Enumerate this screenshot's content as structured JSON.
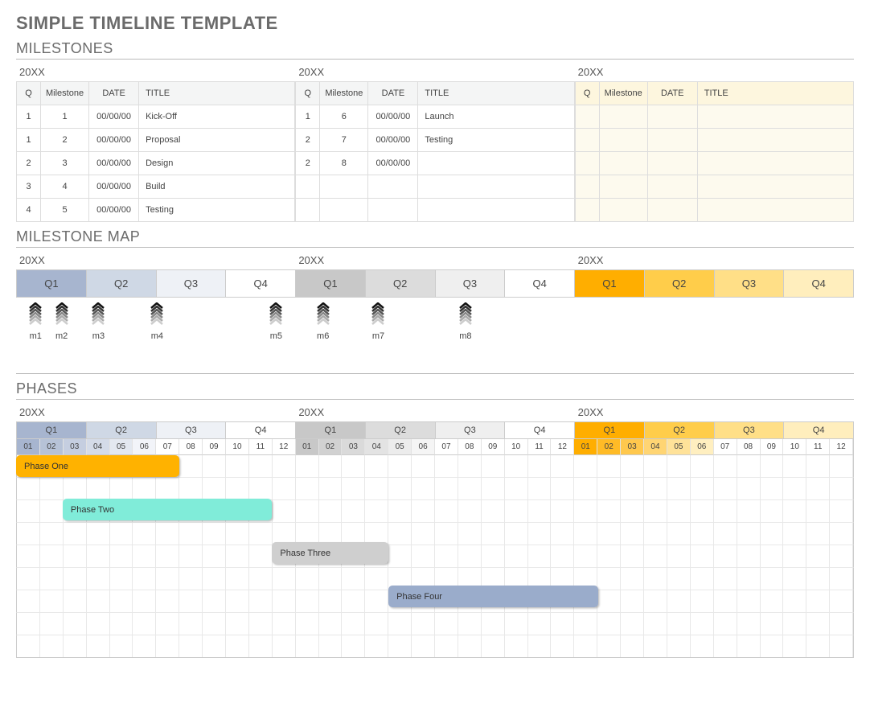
{
  "title": "SIMPLE TIMELINE TEMPLATE",
  "sections": {
    "milestones": "MILESTONES",
    "map": "MILESTONE MAP",
    "phases": "PHASES"
  },
  "years": [
    "20XX",
    "20XX",
    "20XX"
  ],
  "table_headers": [
    "Q",
    "Milestone",
    "DATE",
    "TITLE"
  ],
  "milestones": [
    [
      {
        "q": "1",
        "m": "1",
        "date": "00/00/00",
        "title": "Kick-Off"
      },
      {
        "q": "1",
        "m": "2",
        "date": "00/00/00",
        "title": "Proposal"
      },
      {
        "q": "2",
        "m": "3",
        "date": "00/00/00",
        "title": "Design"
      },
      {
        "q": "3",
        "m": "4",
        "date": "00/00/00",
        "title": "Build"
      },
      {
        "q": "4",
        "m": "5",
        "date": "00/00/00",
        "title": "Testing"
      }
    ],
    [
      {
        "q": "1",
        "m": "6",
        "date": "00/00/00",
        "title": "Launch"
      },
      {
        "q": "2",
        "m": "7",
        "date": "00/00/00",
        "title": "Testing"
      },
      {
        "q": "2",
        "m": "8",
        "date": "00/00/00",
        "title": ""
      },
      {
        "q": "",
        "m": "",
        "date": "",
        "title": ""
      },
      {
        "q": "",
        "m": "",
        "date": "",
        "title": ""
      }
    ],
    [
      {
        "q": "",
        "m": "",
        "date": "",
        "title": ""
      },
      {
        "q": "",
        "m": "",
        "date": "",
        "title": ""
      },
      {
        "q": "",
        "m": "",
        "date": "",
        "title": ""
      },
      {
        "q": "",
        "m": "",
        "date": "",
        "title": ""
      },
      {
        "q": "",
        "m": "",
        "date": "",
        "title": ""
      }
    ]
  ],
  "map_quarters": [
    {
      "label": "Q1",
      "bg": "#a7b5cf"
    },
    {
      "label": "Q2",
      "bg": "#cfd8e5"
    },
    {
      "label": "Q3",
      "bg": "#eef1f6"
    },
    {
      "label": "Q4",
      "bg": "#ffffff"
    },
    {
      "label": "Q1",
      "bg": "#c8c8c8"
    },
    {
      "label": "Q2",
      "bg": "#dcdcdc"
    },
    {
      "label": "Q3",
      "bg": "#efefef"
    },
    {
      "label": "Q4",
      "bg": "#ffffff"
    },
    {
      "label": "Q1",
      "bg": "#ffae00"
    },
    {
      "label": "Q2",
      "bg": "#ffcd4a"
    },
    {
      "label": "Q3",
      "bg": "#ffdf87"
    },
    {
      "label": "Q4",
      "bg": "#ffeebd"
    }
  ],
  "map_arrows": [
    {
      "label": "m1",
      "pos": 0.7
    },
    {
      "label": "m2",
      "pos": 3.8
    },
    {
      "label": "m3",
      "pos": 8.2
    },
    {
      "label": "m4",
      "pos": 15.2
    },
    {
      "label": "m5",
      "pos": 29.4
    },
    {
      "label": "m6",
      "pos": 35.0
    },
    {
      "label": "m7",
      "pos": 41.6
    },
    {
      "label": "m8",
      "pos": 52.0
    }
  ],
  "phase_quarters": [
    {
      "label": "Q1",
      "bg": "#a7b5cf"
    },
    {
      "label": "Q2",
      "bg": "#cfd8e5"
    },
    {
      "label": "Q3",
      "bg": "#eef1f6"
    },
    {
      "label": "Q4",
      "bg": "#ffffff"
    },
    {
      "label": "Q1",
      "bg": "#c8c8c8"
    },
    {
      "label": "Q2",
      "bg": "#dcdcdc"
    },
    {
      "label": "Q3",
      "bg": "#efefef"
    },
    {
      "label": "Q4",
      "bg": "#ffffff"
    },
    {
      "label": "Q1",
      "bg": "#ffae00"
    },
    {
      "label": "Q2",
      "bg": "#ffcd4a"
    },
    {
      "label": "Q3",
      "bg": "#ffdf87"
    },
    {
      "label": "Q4",
      "bg": "#ffeebd"
    }
  ],
  "phase_months": [
    {
      "n": "01",
      "bg": "#a7b5cf"
    },
    {
      "n": "02",
      "bg": "#b6c2d7"
    },
    {
      "n": "03",
      "bg": "#c5cee0"
    },
    {
      "n": "04",
      "bg": "#d4dbe8"
    },
    {
      "n": "05",
      "bg": "#e3e8f0"
    },
    {
      "n": "06",
      "bg": "#f2f4f9"
    },
    {
      "n": "07",
      "bg": "#ffffff"
    },
    {
      "n": "08",
      "bg": "#ffffff"
    },
    {
      "n": "09",
      "bg": "#ffffff"
    },
    {
      "n": "10",
      "bg": "#ffffff"
    },
    {
      "n": "11",
      "bg": "#ffffff"
    },
    {
      "n": "12",
      "bg": "#ffffff"
    },
    {
      "n": "01",
      "bg": "#c8c8c8"
    },
    {
      "n": "02",
      "bg": "#d1d1d1"
    },
    {
      "n": "03",
      "bg": "#dadada"
    },
    {
      "n": "04",
      "bg": "#e3e3e3"
    },
    {
      "n": "05",
      "bg": "#ececec"
    },
    {
      "n": "06",
      "bg": "#f5f5f5"
    },
    {
      "n": "07",
      "bg": "#ffffff"
    },
    {
      "n": "08",
      "bg": "#ffffff"
    },
    {
      "n": "09",
      "bg": "#ffffff"
    },
    {
      "n": "10",
      "bg": "#ffffff"
    },
    {
      "n": "11",
      "bg": "#ffffff"
    },
    {
      "n": "12",
      "bg": "#ffffff"
    },
    {
      "n": "01",
      "bg": "#ffae00"
    },
    {
      "n": "02",
      "bg": "#ffbb26"
    },
    {
      "n": "03",
      "bg": "#ffc84d"
    },
    {
      "n": "04",
      "bg": "#ffd573"
    },
    {
      "n": "05",
      "bg": "#ffe299"
    },
    {
      "n": "06",
      "bg": "#ffefc0"
    },
    {
      "n": "07",
      "bg": "#ffffff"
    },
    {
      "n": "08",
      "bg": "#ffffff"
    },
    {
      "n": "09",
      "bg": "#ffffff"
    },
    {
      "n": "10",
      "bg": "#ffffff"
    },
    {
      "n": "11",
      "bg": "#ffffff"
    },
    {
      "n": "12",
      "bg": "#ffffff"
    }
  ],
  "phase_bars": [
    {
      "label": "Phase One",
      "row": 0,
      "start": 0,
      "span": 7,
      "bg": "#ffb200"
    },
    {
      "label": "Phase Two",
      "row": 2,
      "start": 2,
      "span": 9,
      "bg": "#80ecd9"
    },
    {
      "label": "Phase Three",
      "row": 4,
      "start": 11,
      "span": 5,
      "bg": "#cfcfcf"
    },
    {
      "label": "Phase Four",
      "row": 6,
      "start": 16,
      "span": 9,
      "bg": "#9aaccb"
    }
  ],
  "phase_row_count": 9
}
